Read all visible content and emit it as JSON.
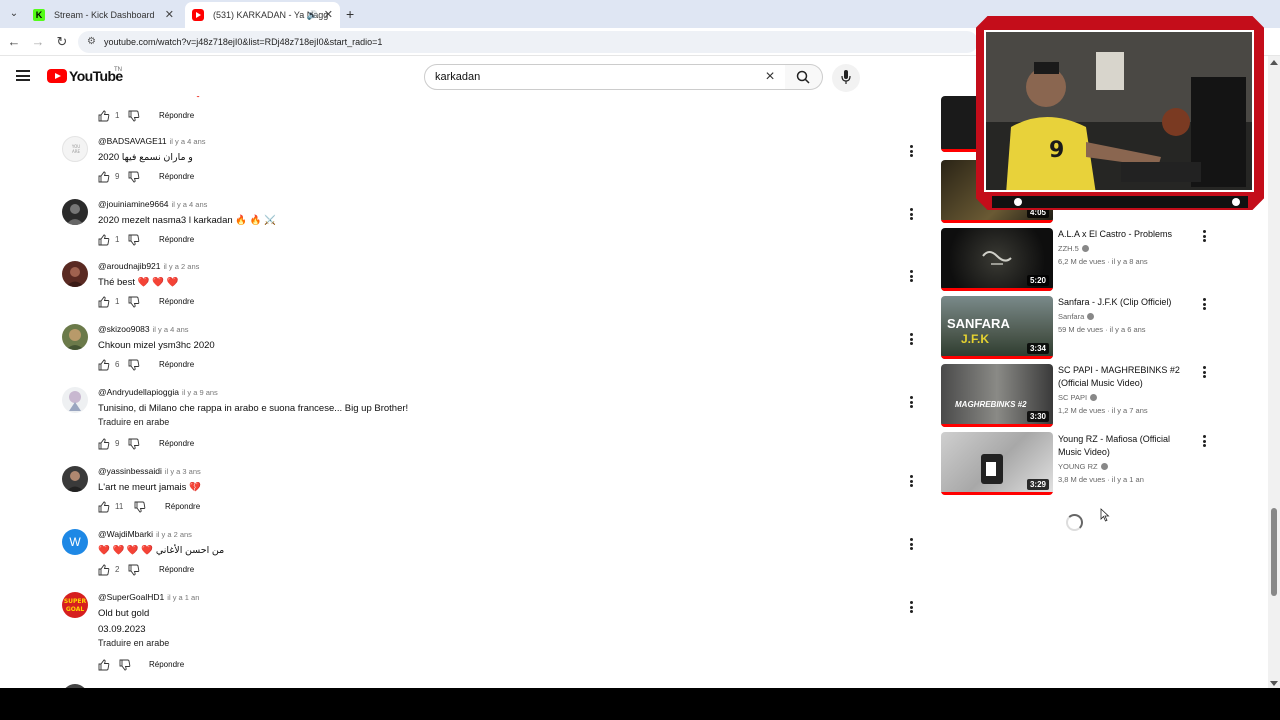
{
  "browser": {
    "tabs": [
      {
        "title": "Stream - Kick Dashboard",
        "active": false
      },
      {
        "title": "(531) KARKADAN - Ya Nagg",
        "active": true
      }
    ],
    "url": "youtube.com/watch?v=j48z718ejI0&list=RDj48z718ejI0&start_radio=1"
  },
  "youtube": {
    "logo_text": "YouTube",
    "logo_region": "TN",
    "search_value": "karkadan"
  },
  "comments": [
    {
      "author": "",
      "time": "",
      "text": "",
      "likes": "1",
      "reply": "Répondre",
      "partial": true
    },
    {
      "author": "@BADSAVAGE11",
      "time": "il y a 4 ans",
      "text": "2020 و ماران نسمع فيها",
      "likes": "9",
      "reply": "Répondre"
    },
    {
      "author": "@jouiniamine9664",
      "time": "il y a 4 ans",
      "text": "2020 mezelt nasma3 l karkadan 🔥 🔥 ⚔️",
      "likes": "1",
      "reply": "Répondre"
    },
    {
      "author": "@aroudnajib921",
      "time": "il y a 2 ans",
      "text": "Thé best ❤️ ❤️ ❤️",
      "likes": "1",
      "reply": "Répondre"
    },
    {
      "author": "@skizoo9083",
      "time": "il y a 4 ans",
      "text": "Chkoun mizel ysm3hc 2020",
      "likes": "6",
      "reply": "Répondre"
    },
    {
      "author": "@Andryudellapioggia",
      "time": "il y a 9 ans",
      "text": "Tunisino, di Milano che rappa in arabo e suona francese... Big up Brother!",
      "translate": "Traduire en arabe",
      "likes": "9",
      "reply": "Répondre"
    },
    {
      "author": "@yassinbessaidi",
      "time": "il y a 3 ans",
      "text": "L'art ne meurt jamais 💔",
      "likes": "11",
      "reply": "Répondre"
    },
    {
      "author": "@WajdiMbarki",
      "time": "il y a 2 ans",
      "text": "❤️ ❤️ ❤️ ❤️ من احسن الأغاني",
      "likes": "2",
      "reply": "Répondre",
      "avatar_letter": "W"
    },
    {
      "author": "@SuperGoalHD1",
      "time": "il y a 1 an",
      "text": "Old but gold\n03.09.2023",
      "translate": "Traduire en arabe",
      "likes": "",
      "reply": "Répondre"
    }
  ],
  "sidebar": {
    "videos": [
      {
        "title": "",
        "channel": "",
        "meta": "",
        "duration": "",
        "partial": true
      },
      {
        "title": "",
        "channel": "",
        "meta": "",
        "duration": "4:05",
        "partial": true
      },
      {
        "title": "A.L.A x El Castro - Problems",
        "channel": "ZZH.5",
        "meta": "6,2 M de vues · il y a 8 ans",
        "duration": "5:20"
      },
      {
        "title": "Sanfara - J.F.K (Clip Officiel)",
        "channel": "Sanfara",
        "meta": "59 M de vues · il y a 6 ans",
        "duration": "3:34",
        "thumb_text": "SANFARA",
        "thumb_sub": "J.F.K"
      },
      {
        "title": "SC PAPI - MAGHREBINKS #2 (Official Music Video)",
        "channel": "SC PAPI",
        "meta": "1,2 M de vues · il y a 7 ans",
        "duration": "3:30",
        "thumb_text": "MAGHREBINKS #2"
      },
      {
        "title": "Young RZ - Mafiosa (Official Music Video)",
        "channel": "YOUNG RZ",
        "meta": "3,8 M de vues · il y a 1 an",
        "duration": "3:29"
      }
    ]
  },
  "colors": {
    "accent": "#ff0000",
    "cam_frame": "#c40d1a",
    "kick": "#53fc18"
  }
}
